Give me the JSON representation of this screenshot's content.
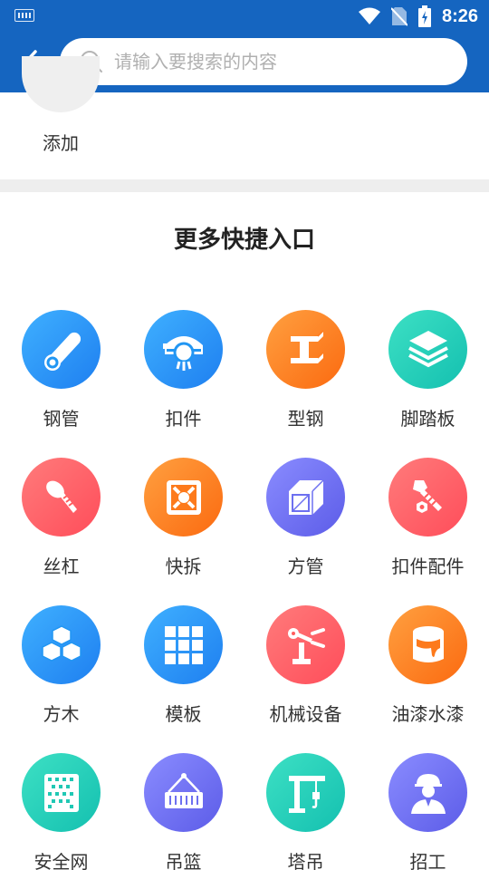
{
  "status_bar": {
    "time": "8:26"
  },
  "search": {
    "placeholder": "请输入要搜索的内容"
  },
  "add_section": {
    "label": "添加"
  },
  "section_title": "更多快捷入口",
  "colors": {
    "blue": "#2196f3",
    "orange": "#fd7a1c",
    "teal": "#20c8b4",
    "red": "#ff5d5d",
    "purple": "#6d70f0"
  },
  "shortcuts": [
    {
      "label": "钢管",
      "icon": "pipe-icon",
      "color": "blue"
    },
    {
      "label": "扣件",
      "icon": "fastener-icon",
      "color": "blue"
    },
    {
      "label": "型钢",
      "icon": "steel-beam-icon",
      "color": "orange"
    },
    {
      "label": "脚踏板",
      "icon": "layers-icon",
      "color": "teal"
    },
    {
      "label": "丝杠",
      "icon": "screw-icon",
      "color": "red"
    },
    {
      "label": "快拆",
      "icon": "quick-release-icon",
      "color": "orange"
    },
    {
      "label": "方管",
      "icon": "square-tube-icon",
      "color": "purple"
    },
    {
      "label": "扣件配件",
      "icon": "bolt-nut-icon",
      "color": "red"
    },
    {
      "label": "方木",
      "icon": "cubes-icon",
      "color": "blue"
    },
    {
      "label": "模板",
      "icon": "formwork-grid-icon",
      "color": "blue"
    },
    {
      "label": "机械设备",
      "icon": "robot-arm-icon",
      "color": "red"
    },
    {
      "label": "油漆水漆",
      "icon": "paint-bucket-icon",
      "color": "orange"
    },
    {
      "label": "安全网",
      "icon": "safety-net-icon",
      "color": "teal"
    },
    {
      "label": "吊篮",
      "icon": "hanging-basket-icon",
      "color": "purple"
    },
    {
      "label": "塔吊",
      "icon": "tower-crane-icon",
      "color": "teal"
    },
    {
      "label": "招工",
      "icon": "worker-icon",
      "color": "purple"
    }
  ]
}
